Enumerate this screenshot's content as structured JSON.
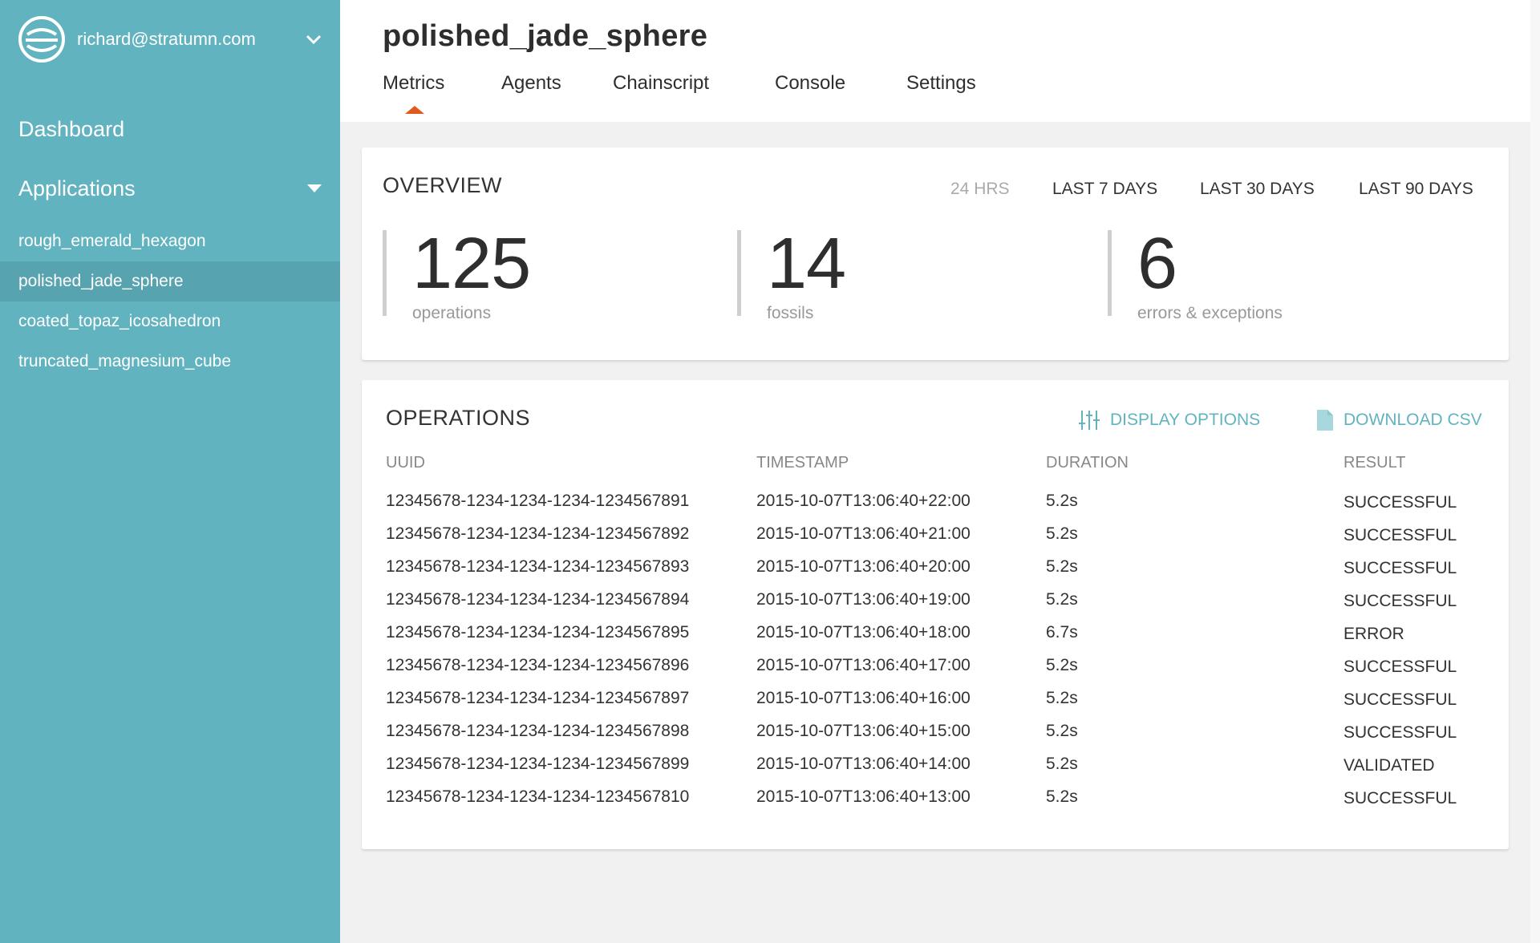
{
  "sidebar": {
    "account_email": "richard@stratumn.com",
    "dashboard_label": "Dashboard",
    "applications_label": "Applications",
    "apps": [
      {
        "label": "rough_emerald_hexagon",
        "active": false
      },
      {
        "label": "polished_jade_sphere",
        "active": true
      },
      {
        "label": "coated_topaz_icosahedron",
        "active": false
      },
      {
        "label": "truncated_magnesium_cube",
        "active": false
      }
    ]
  },
  "header": {
    "title": "polished_jade_sphere",
    "tabs": [
      {
        "label": "Metrics",
        "active": true
      },
      {
        "label": "Agents",
        "active": false
      },
      {
        "label": "Chainscript",
        "active": false
      },
      {
        "label": "Console",
        "active": false
      },
      {
        "label": "Settings",
        "active": false
      }
    ]
  },
  "overview": {
    "title": "OVERVIEW",
    "ranges": [
      {
        "label": "24 HRS",
        "active": false
      },
      {
        "label": "LAST 7 DAYS",
        "active": true
      },
      {
        "label": "LAST 30 DAYS",
        "active": true
      },
      {
        "label": "LAST 90 DAYS",
        "active": true
      }
    ],
    "stats": [
      {
        "value": "125",
        "label": "operations"
      },
      {
        "value": "14",
        "label": "fossils"
      },
      {
        "value": "6",
        "label": "errors & exceptions"
      }
    ]
  },
  "operations": {
    "title": "OPERATIONS",
    "display_options_label": "DISPLAY OPTIONS",
    "download_csv_label": "DOWNLOAD CSV",
    "columns": [
      "UUID",
      "TIMESTAMP",
      "DURATION",
      "RESULT"
    ],
    "rows": [
      [
        "12345678-1234-1234-1234-1234567891",
        "2015-10-07T13:06:40+22:00",
        "5.2s",
        "SUCCESSFUL"
      ],
      [
        "12345678-1234-1234-1234-1234567892",
        "2015-10-07T13:06:40+21:00",
        "5.2s",
        "SUCCESSFUL"
      ],
      [
        "12345678-1234-1234-1234-1234567893",
        "2015-10-07T13:06:40+20:00",
        "5.2s",
        "SUCCESSFUL"
      ],
      [
        "12345678-1234-1234-1234-1234567894",
        "2015-10-07T13:06:40+19:00",
        "5.2s",
        "SUCCESSFUL"
      ],
      [
        "12345678-1234-1234-1234-1234567895",
        "2015-10-07T13:06:40+18:00",
        "6.7s",
        "ERROR"
      ],
      [
        "12345678-1234-1234-1234-1234567896",
        "2015-10-07T13:06:40+17:00",
        "5.2s",
        "SUCCESSFUL"
      ],
      [
        "12345678-1234-1234-1234-1234567897",
        "2015-10-07T13:06:40+16:00",
        "5.2s",
        "SUCCESSFUL"
      ],
      [
        "12345678-1234-1234-1234-1234567898",
        "2015-10-07T13:06:40+15:00",
        "5.2s",
        "SUCCESSFUL"
      ],
      [
        "12345678-1234-1234-1234-1234567899",
        "2015-10-07T13:06:40+14:00",
        "5.2s",
        "VALIDATED"
      ],
      [
        "12345678-1234-1234-1234-1234567810",
        "2015-10-07T13:06:40+13:00",
        "5.2s",
        "SUCCESSFUL"
      ]
    ]
  },
  "colors": {
    "sidebar": "#62b3c0",
    "sidebar_active": "#58a3b0",
    "accent": "#62b3c0",
    "tab_indicator": "#e05a1e"
  }
}
